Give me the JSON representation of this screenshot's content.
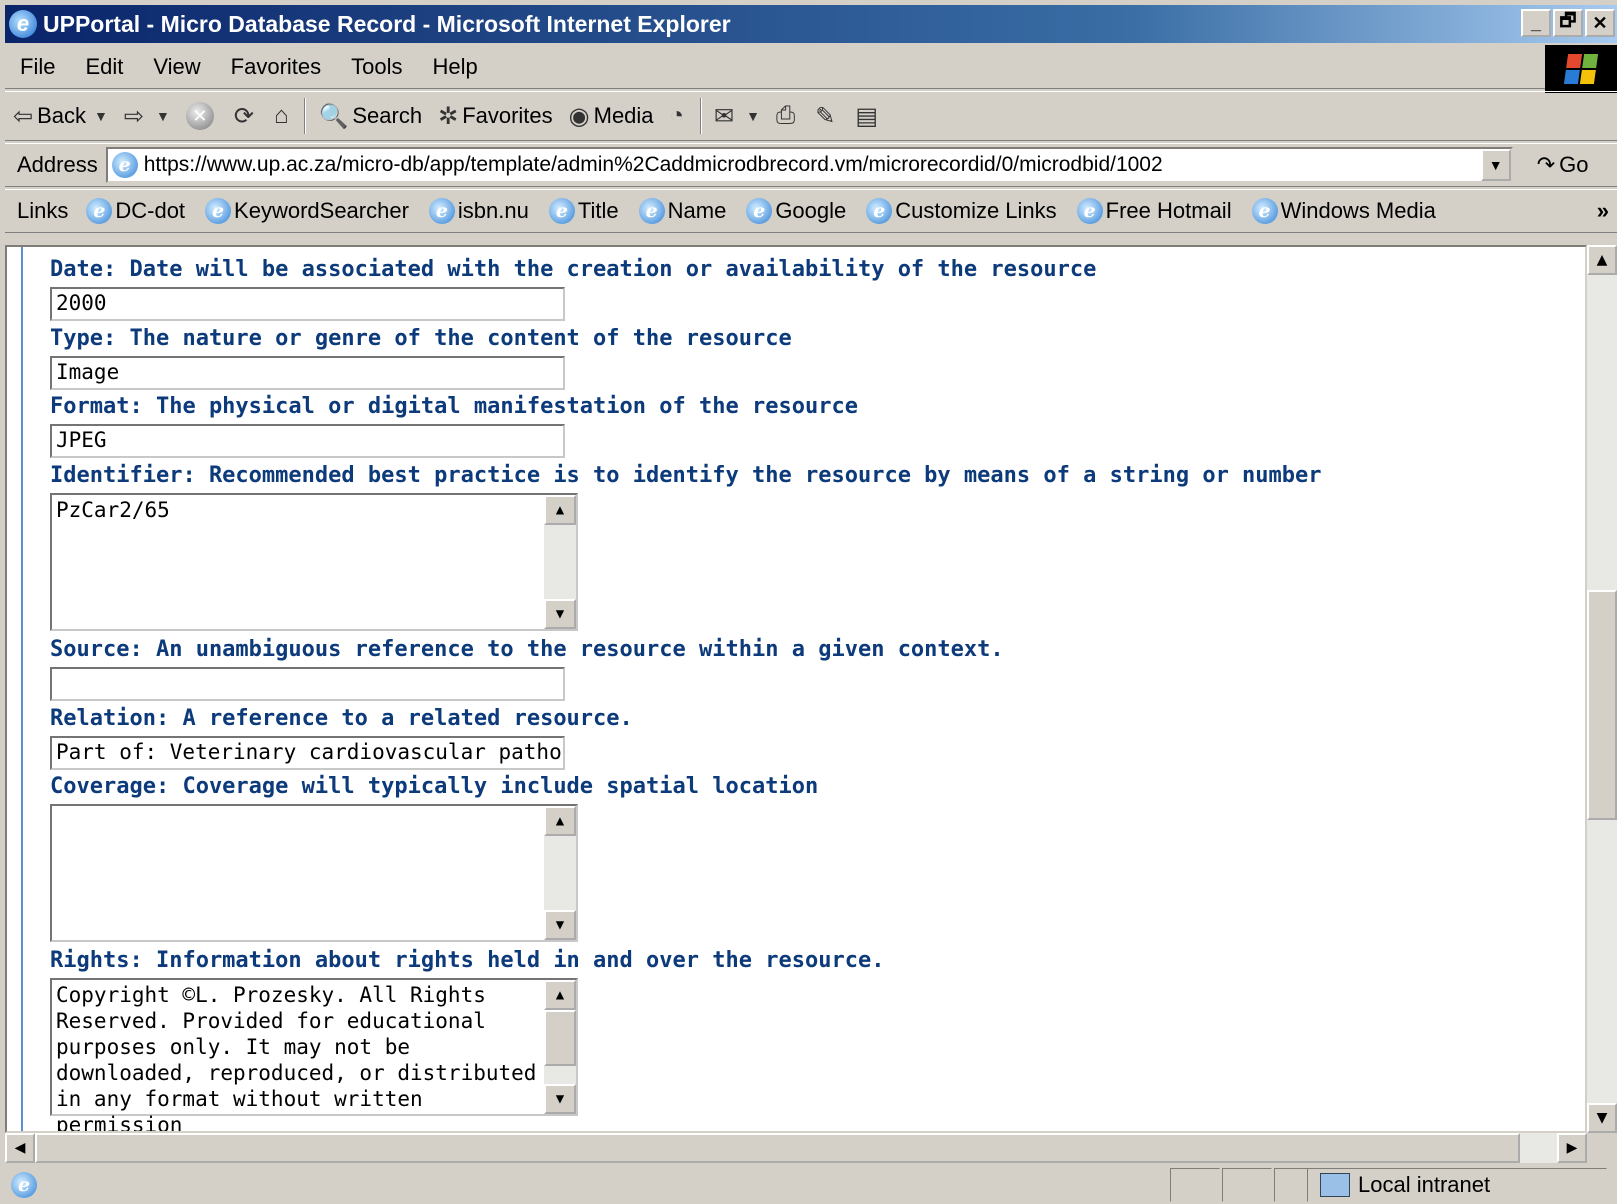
{
  "window": {
    "title": "UPPortal - Micro Database Record - Microsoft Internet Explorer",
    "controls": [
      "_",
      "🗗",
      "✕"
    ]
  },
  "menubar": {
    "items": [
      "File",
      "Edit",
      "View",
      "Favorites",
      "Tools",
      "Help"
    ]
  },
  "toolbar": {
    "back_label": "Back",
    "search_label": "Search",
    "favorites_label": "Favorites",
    "media_label": "Media"
  },
  "addressbar": {
    "label": "Address",
    "url": "https://www.up.ac.za/micro-db/app/template/admin%2Caddmicrodbrecord.vm/microrecordid/0/microdbid/1002",
    "go_label": "Go"
  },
  "linksbar": {
    "label": "Links",
    "items": [
      "DC-dot",
      "KeywordSearcher",
      "isbn.nu",
      "Title",
      "Name",
      "Google",
      "Customize Links",
      "Free Hotmail",
      "Windows Media"
    ],
    "overflow": "»"
  },
  "form": {
    "date": {
      "label": "Date: Date will be associated with the creation or availability of the resource",
      "value": "2000"
    },
    "type": {
      "label": "Type: The nature or genre of the content of the resource",
      "value": "Image"
    },
    "format": {
      "label": "Format: The physical or digital manifestation of the resource",
      "value": "JPEG"
    },
    "identifier": {
      "label": "Identifier: Recommended best practice is to identify the resource by means of a string or number",
      "value": "PzCar2/65"
    },
    "source": {
      "label": "Source: An unambiguous reference to the resource within a given context.",
      "value": ""
    },
    "relation": {
      "label": "Relation: A reference to a related resource.",
      "value": "Part of: Veterinary cardiovascular pathology"
    },
    "coverage": {
      "label": "Coverage: Coverage will typically include spatial location",
      "value": ""
    },
    "rights": {
      "label": "Rights: Information about rights held in and over the resource.",
      "value": "Copyright ©L. Prozesky. All Rights\nReserved. Provided for educational\npurposes only. It may not be\ndownloaded, reproduced, or distributed\nin any format without written permission"
    }
  },
  "statusbar": {
    "zone_label": "Local intranet"
  }
}
